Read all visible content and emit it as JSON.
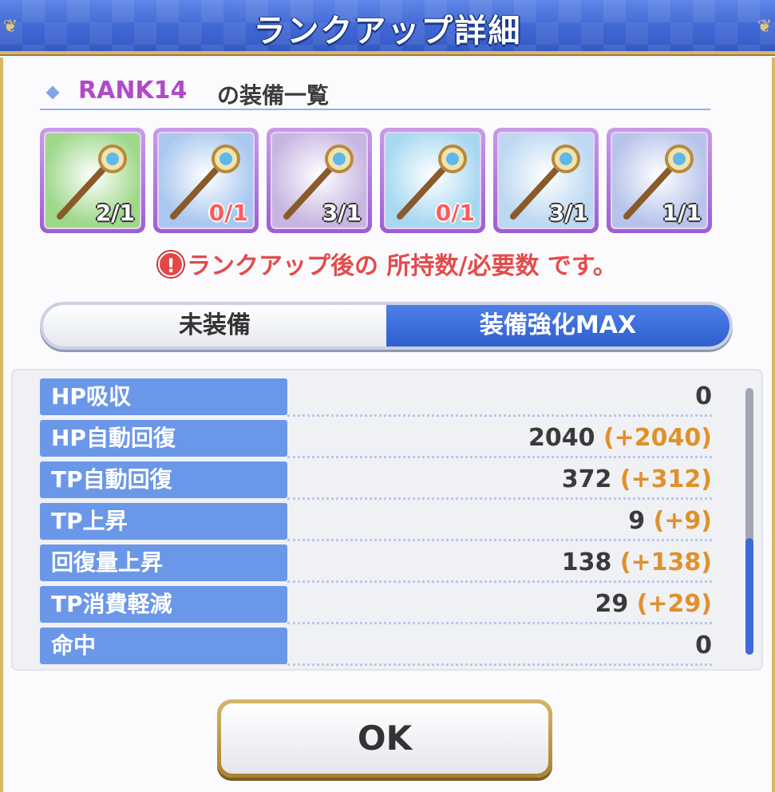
{
  "title": "ランクアップ詳細",
  "rank": {
    "label": "RANK14",
    "suffix": "の装備一覧"
  },
  "equipment": [
    {
      "icon": "green-vine-staff-icon",
      "count": "2/1",
      "short": false,
      "color": "#9ed88a"
    },
    {
      "icon": "blue-orb-scepter-icon",
      "count": "0/1",
      "short": true,
      "color": "#a9c7ef"
    },
    {
      "icon": "silver-veil-icon",
      "count": "3/1",
      "short": false,
      "color": "#c8b6e2"
    },
    {
      "icon": "teal-wand-icon",
      "count": "0/1",
      "short": true,
      "color": "#a8d8f0"
    },
    {
      "icon": "white-ribbon-icon",
      "count": "3/1",
      "short": false,
      "color": "#bcd8f2"
    },
    {
      "icon": "navy-bracelet-icon",
      "count": "1/1",
      "short": false,
      "color": "#b7c4ea"
    }
  ],
  "note": "ランクアップ後の 所持数/必要数 です。",
  "toggle": {
    "off_label": "未装備",
    "on_label": "装備強化MAX"
  },
  "stats": [
    {
      "label": "HP吸収",
      "value": "0",
      "bonus": ""
    },
    {
      "label": "HP自動回復",
      "value": "2040",
      "bonus": "(+2040)"
    },
    {
      "label": "TP自動回復",
      "value": "372",
      "bonus": "(+312)"
    },
    {
      "label": "TP上昇",
      "value": "9",
      "bonus": "(+9)"
    },
    {
      "label": "回復量上昇",
      "value": "138",
      "bonus": "(+138)"
    },
    {
      "label": "TP消費軽減",
      "value": "29",
      "bonus": "(+29)"
    },
    {
      "label": "命中",
      "value": "0",
      "bonus": ""
    }
  ],
  "ok_label": "OK"
}
